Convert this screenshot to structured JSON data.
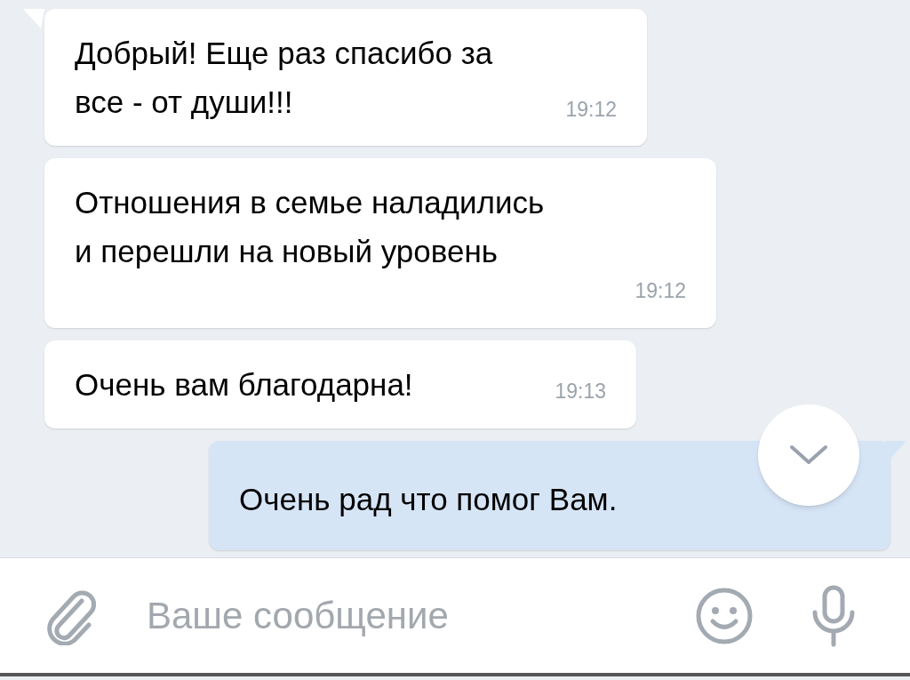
{
  "messages": [
    {
      "kind": "incoming",
      "tail": true,
      "text": "Добрый! Еще раз спасибо за все - от души!!!",
      "time": "19:12"
    },
    {
      "kind": "incoming",
      "tail": false,
      "text": "Отношения в семье наладились и перешли на новый уровень",
      "time": "19:12"
    },
    {
      "kind": "incoming",
      "tail": false,
      "text": "Очень вам благодарна!",
      "time": "19:13"
    },
    {
      "kind": "outgoing",
      "tail": true,
      "text": "Очень рад что помог Вам."
    }
  ],
  "composer": {
    "placeholder": "Ваше сообщение"
  }
}
